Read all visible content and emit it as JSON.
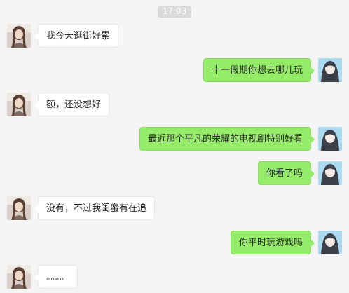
{
  "timestamp": "17:03",
  "messages": [
    {
      "side": "left",
      "text": "我今天逛街好累"
    },
    {
      "side": "right",
      "text": "十一假期你想去哪儿玩"
    },
    {
      "side": "left",
      "text": "额，还没想好"
    },
    {
      "side": "right",
      "text": "最近那个平凡的荣耀的电视剧特别好看"
    },
    {
      "side": "right",
      "text": "你看了吗"
    },
    {
      "side": "left",
      "text": "没有，不过我闺蜜有在追"
    },
    {
      "side": "right",
      "text": "你平时玩游戏吗"
    },
    {
      "side": "left",
      "text": "。。。。"
    }
  ],
  "colors": {
    "background": "#f5f5f5",
    "incoming_bubble": "#ffffff",
    "outgoing_bubble": "#95ec69"
  }
}
